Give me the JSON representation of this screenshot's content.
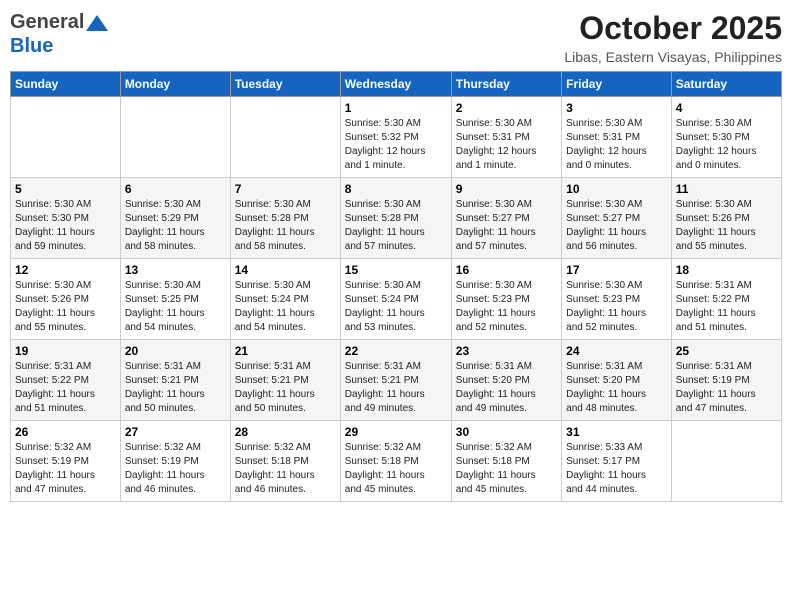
{
  "header": {
    "logo_general": "General",
    "logo_blue": "Blue",
    "month_title": "October 2025",
    "location": "Libas, Eastern Visayas, Philippines"
  },
  "weekdays": [
    "Sunday",
    "Monday",
    "Tuesday",
    "Wednesday",
    "Thursday",
    "Friday",
    "Saturday"
  ],
  "weeks": [
    [
      {
        "day": "",
        "info": ""
      },
      {
        "day": "",
        "info": ""
      },
      {
        "day": "",
        "info": ""
      },
      {
        "day": "1",
        "info": "Sunrise: 5:30 AM\nSunset: 5:32 PM\nDaylight: 12 hours\nand 1 minute."
      },
      {
        "day": "2",
        "info": "Sunrise: 5:30 AM\nSunset: 5:31 PM\nDaylight: 12 hours\nand 1 minute."
      },
      {
        "day": "3",
        "info": "Sunrise: 5:30 AM\nSunset: 5:31 PM\nDaylight: 12 hours\nand 0 minutes."
      },
      {
        "day": "4",
        "info": "Sunrise: 5:30 AM\nSunset: 5:30 PM\nDaylight: 12 hours\nand 0 minutes."
      }
    ],
    [
      {
        "day": "5",
        "info": "Sunrise: 5:30 AM\nSunset: 5:30 PM\nDaylight: 11 hours\nand 59 minutes."
      },
      {
        "day": "6",
        "info": "Sunrise: 5:30 AM\nSunset: 5:29 PM\nDaylight: 11 hours\nand 58 minutes."
      },
      {
        "day": "7",
        "info": "Sunrise: 5:30 AM\nSunset: 5:28 PM\nDaylight: 11 hours\nand 58 minutes."
      },
      {
        "day": "8",
        "info": "Sunrise: 5:30 AM\nSunset: 5:28 PM\nDaylight: 11 hours\nand 57 minutes."
      },
      {
        "day": "9",
        "info": "Sunrise: 5:30 AM\nSunset: 5:27 PM\nDaylight: 11 hours\nand 57 minutes."
      },
      {
        "day": "10",
        "info": "Sunrise: 5:30 AM\nSunset: 5:27 PM\nDaylight: 11 hours\nand 56 minutes."
      },
      {
        "day": "11",
        "info": "Sunrise: 5:30 AM\nSunset: 5:26 PM\nDaylight: 11 hours\nand 55 minutes."
      }
    ],
    [
      {
        "day": "12",
        "info": "Sunrise: 5:30 AM\nSunset: 5:26 PM\nDaylight: 11 hours\nand 55 minutes."
      },
      {
        "day": "13",
        "info": "Sunrise: 5:30 AM\nSunset: 5:25 PM\nDaylight: 11 hours\nand 54 minutes."
      },
      {
        "day": "14",
        "info": "Sunrise: 5:30 AM\nSunset: 5:24 PM\nDaylight: 11 hours\nand 54 minutes."
      },
      {
        "day": "15",
        "info": "Sunrise: 5:30 AM\nSunset: 5:24 PM\nDaylight: 11 hours\nand 53 minutes."
      },
      {
        "day": "16",
        "info": "Sunrise: 5:30 AM\nSunset: 5:23 PM\nDaylight: 11 hours\nand 52 minutes."
      },
      {
        "day": "17",
        "info": "Sunrise: 5:30 AM\nSunset: 5:23 PM\nDaylight: 11 hours\nand 52 minutes."
      },
      {
        "day": "18",
        "info": "Sunrise: 5:31 AM\nSunset: 5:22 PM\nDaylight: 11 hours\nand 51 minutes."
      }
    ],
    [
      {
        "day": "19",
        "info": "Sunrise: 5:31 AM\nSunset: 5:22 PM\nDaylight: 11 hours\nand 51 minutes."
      },
      {
        "day": "20",
        "info": "Sunrise: 5:31 AM\nSunset: 5:21 PM\nDaylight: 11 hours\nand 50 minutes."
      },
      {
        "day": "21",
        "info": "Sunrise: 5:31 AM\nSunset: 5:21 PM\nDaylight: 11 hours\nand 50 minutes."
      },
      {
        "day": "22",
        "info": "Sunrise: 5:31 AM\nSunset: 5:21 PM\nDaylight: 11 hours\nand 49 minutes."
      },
      {
        "day": "23",
        "info": "Sunrise: 5:31 AM\nSunset: 5:20 PM\nDaylight: 11 hours\nand 49 minutes."
      },
      {
        "day": "24",
        "info": "Sunrise: 5:31 AM\nSunset: 5:20 PM\nDaylight: 11 hours\nand 48 minutes."
      },
      {
        "day": "25",
        "info": "Sunrise: 5:31 AM\nSunset: 5:19 PM\nDaylight: 11 hours\nand 47 minutes."
      }
    ],
    [
      {
        "day": "26",
        "info": "Sunrise: 5:32 AM\nSunset: 5:19 PM\nDaylight: 11 hours\nand 47 minutes."
      },
      {
        "day": "27",
        "info": "Sunrise: 5:32 AM\nSunset: 5:19 PM\nDaylight: 11 hours\nand 46 minutes."
      },
      {
        "day": "28",
        "info": "Sunrise: 5:32 AM\nSunset: 5:18 PM\nDaylight: 11 hours\nand 46 minutes."
      },
      {
        "day": "29",
        "info": "Sunrise: 5:32 AM\nSunset: 5:18 PM\nDaylight: 11 hours\nand 45 minutes."
      },
      {
        "day": "30",
        "info": "Sunrise: 5:32 AM\nSunset: 5:18 PM\nDaylight: 11 hours\nand 45 minutes."
      },
      {
        "day": "31",
        "info": "Sunrise: 5:33 AM\nSunset: 5:17 PM\nDaylight: 11 hours\nand 44 minutes."
      },
      {
        "day": "",
        "info": ""
      }
    ]
  ]
}
